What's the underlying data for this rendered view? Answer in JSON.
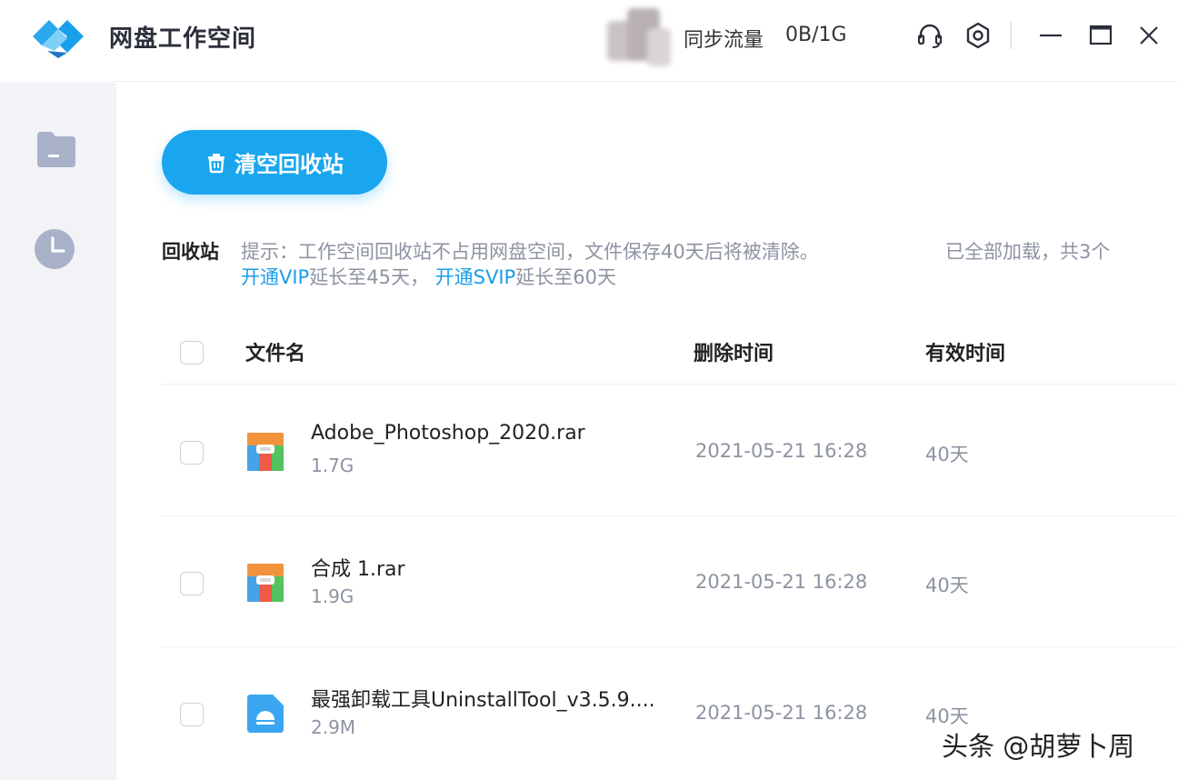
{
  "app": {
    "title": "网盘工作空间"
  },
  "titlebar": {
    "sync_label": "同步流量",
    "sync_value": "0B/1G",
    "icons": [
      "headset-icon",
      "settings-icon",
      "minimize-icon",
      "maximize-icon",
      "close-icon"
    ]
  },
  "sidebar": {
    "items": [
      {
        "icon": "folder-icon"
      },
      {
        "icon": "clock-icon"
      }
    ]
  },
  "main": {
    "clear_button_label": "清空回收站",
    "section_title": "回收站",
    "tip_line1": "提示：工作空间回收站不占用网盘空间，文件保存40天后将被清除。",
    "tip_vip_link": "开通VIP",
    "tip_vip_text": "延长至45天，",
    "tip_svip_link": "开通SVIP",
    "tip_svip_text": "延长至60天",
    "loaded_text": "已全部加载，共3个",
    "columns": {
      "name": "文件名",
      "deleted_time": "删除时间",
      "valid_time": "有效时间"
    },
    "files": [
      {
        "name": "Adobe_Photoshop_2020.rar",
        "size": "1.7G",
        "deleted": "2021-05-21 16:28",
        "valid": "40天",
        "icon": "rar-archive-icon"
      },
      {
        "name": "合成 1.rar",
        "size": "1.9G",
        "deleted": "2021-05-21 16:28",
        "valid": "40天",
        "icon": "rar-archive-icon"
      },
      {
        "name": "最强卸载工具UninstallTool_v3.5.9....",
        "size": "2.9M",
        "deleted": "2021-05-21 16:28",
        "valid": "40天",
        "icon": "installer-icon"
      }
    ]
  },
  "watermark": "头条 @胡萝卜周",
  "colors": {
    "accent": "#1aa6ef",
    "link": "#1a9de8",
    "muted": "#8d93a1",
    "sidebar_bg": "#f2f3f7"
  }
}
